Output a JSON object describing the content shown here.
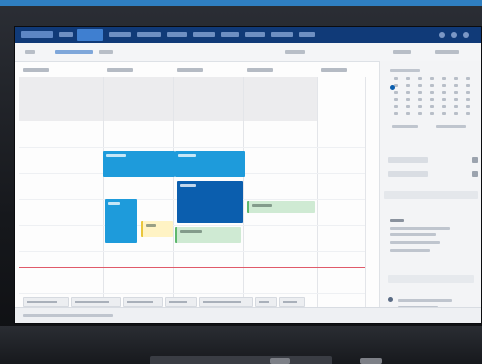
{
  "app": {
    "title": "",
    "brand": ""
  },
  "nav": {
    "items": [
      "",
      "",
      "",
      "",
      "",
      "",
      "",
      "",
      "",
      ""
    ],
    "active_index": 2
  },
  "command_bar": {
    "left_items": [
      "",
      "",
      ""
    ],
    "right_items": [
      "",
      "",
      ""
    ]
  },
  "calendar": {
    "day_headers": [
      "",
      "",
      "",
      "",
      ""
    ],
    "events": [
      {
        "day": 1,
        "kind": "light",
        "title": ""
      },
      {
        "day": 2,
        "kind": "light",
        "title": ""
      },
      {
        "day": 2,
        "kind": "dark",
        "title": ""
      },
      {
        "day": 1,
        "kind": "light",
        "title": ""
      },
      {
        "day": 1,
        "kind": "yellow",
        "title": ""
      },
      {
        "day": 2,
        "kind": "green",
        "title": ""
      },
      {
        "day": 3,
        "kind": "green",
        "title": ""
      }
    ]
  },
  "right_panel": {
    "month_label": "",
    "sections": [
      "",
      "",
      "",
      ""
    ]
  },
  "bottom_tabs": [
    "",
    "",
    "",
    "",
    "",
    "",
    ""
  ],
  "colors": {
    "topbar": "#103a78",
    "accent": "#1e9bdb",
    "accent_dark": "#0b5eae",
    "now_line": "#e05a6a",
    "event_green": "#cfead3",
    "event_yellow": "#fff3c4"
  }
}
